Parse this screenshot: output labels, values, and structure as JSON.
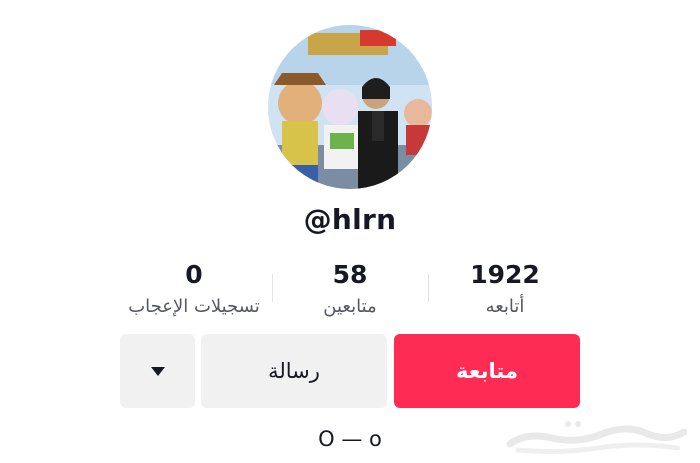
{
  "profile": {
    "username": "@hlrn",
    "bio": "O — o"
  },
  "stats": {
    "following_count": "1922",
    "following_label": "أتابعه",
    "followers_count": "58",
    "followers_label": "متابعين",
    "likes_count": "0",
    "likes_label": "تسجيلات الإعجاب"
  },
  "actions": {
    "follow_label": "متابعة",
    "message_label": "رسالة",
    "dropdown_icon": "caret-down-icon"
  },
  "colors": {
    "accent": "#fe2c55",
    "secondary_button": "#f1f1f2",
    "text": "#161823",
    "muted_text": "#555860"
  }
}
